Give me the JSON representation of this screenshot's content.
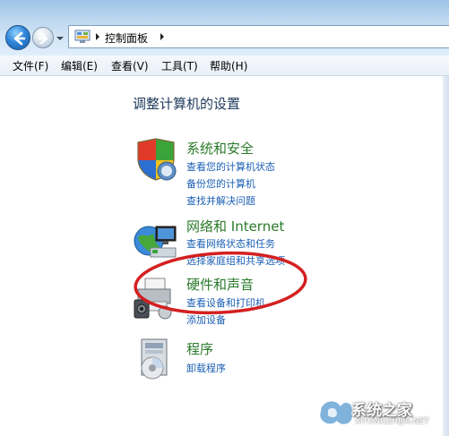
{
  "address_bar": {
    "path": "控制面板"
  },
  "menu": {
    "items": [
      {
        "label": "文件(F)"
      },
      {
        "label": "编辑(E)"
      },
      {
        "label": "查看(V)"
      },
      {
        "label": "工具(T)"
      },
      {
        "label": "帮助(H)"
      }
    ]
  },
  "main": {
    "title": "调整计算机的设置",
    "categories": [
      {
        "title": "系统和安全",
        "icon": "shield-icon",
        "links": [
          "查看您的计算机状态",
          "备份您的计算机",
          "查找并解决问题"
        ]
      },
      {
        "title": "网络和 Internet",
        "icon": "network-globe-icon",
        "links": [
          "查看网络状态和任务",
          "选择家庭组和共享选项"
        ]
      },
      {
        "title": "硬件和声音",
        "icon": "printer-speaker-icon",
        "links": [
          "查看设备和打印机",
          "添加设备"
        ]
      },
      {
        "title": "程序",
        "icon": "programs-box-icon",
        "links": [
          "卸载程序"
        ]
      }
    ]
  },
  "annotation": {
    "color": "#d42020"
  },
  "watermark": {
    "text": "系统之家",
    "url": "XITONGZHIJIA.NET"
  }
}
